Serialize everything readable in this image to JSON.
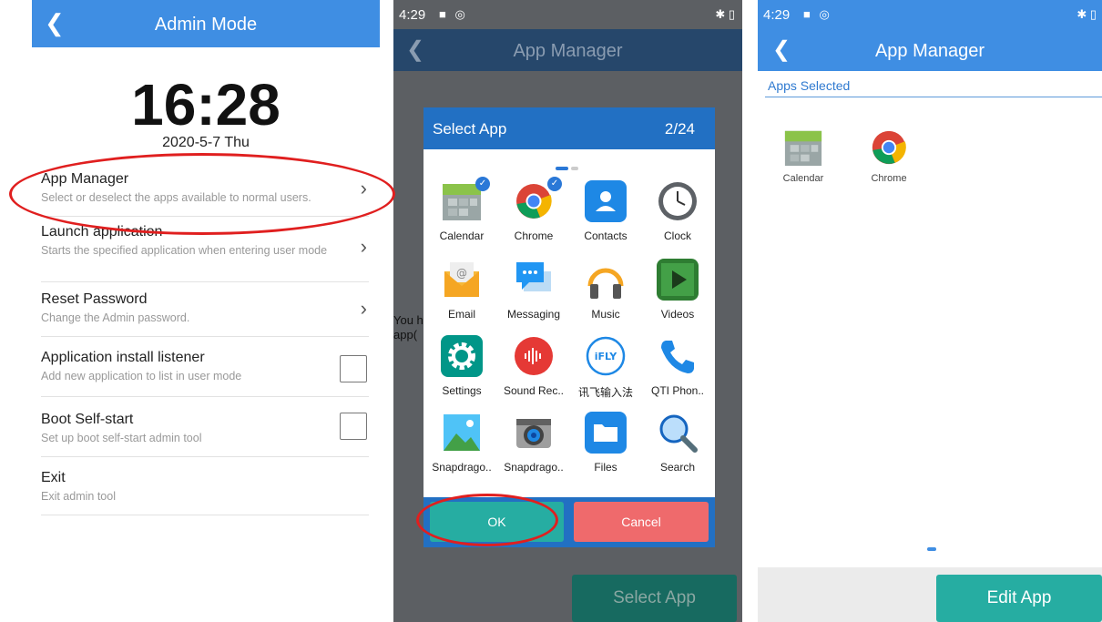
{
  "panel1": {
    "title": "Admin Mode",
    "back_icon": "chevron-left-icon",
    "clock": "16:28",
    "date": "2020-5-7 Thu",
    "items": [
      {
        "title": "App Manager",
        "subtitle": "Select or deselect the apps available to normal users.",
        "control": "chevron"
      },
      {
        "title": "Launch application",
        "subtitle": "Starts the specified application when entering user mode",
        "control": "chevron"
      },
      {
        "title": "Reset Password",
        "subtitle": "Change the Admin password.",
        "control": "chevron"
      },
      {
        "title": "Application install listener",
        "subtitle": "Add new application to list in user mode",
        "control": "checkbox"
      },
      {
        "title": "Boot Self-start",
        "subtitle": "Set up boot self-start admin tool",
        "control": "checkbox"
      },
      {
        "title": "Exit",
        "subtitle": "Exit admin tool",
        "control": "none"
      }
    ],
    "chevron_glyph": "›",
    "highlight_color": "#e01f1f"
  },
  "panel2": {
    "status_time": "4:29",
    "status_icons": "■ ◎",
    "status_right": "✱ ▯",
    "title": "App Manager",
    "background_text": "You h\napp(",
    "select_app_button": "Select App",
    "dialog": {
      "title": "Select App",
      "page": "2/24",
      "apps": [
        {
          "label": "Calendar",
          "icon": "calendar-icon",
          "checked": true
        },
        {
          "label": "Chrome",
          "icon": "chrome-icon",
          "checked": true
        },
        {
          "label": "Contacts",
          "icon": "contacts-icon",
          "checked": false
        },
        {
          "label": "Clock",
          "icon": "clock-icon",
          "checked": false
        },
        {
          "label": "Email",
          "icon": "email-icon",
          "checked": false
        },
        {
          "label": "Messaging",
          "icon": "messaging-icon",
          "checked": false
        },
        {
          "label": "Music",
          "icon": "music-icon",
          "checked": false
        },
        {
          "label": "Videos",
          "icon": "videos-icon",
          "checked": false
        },
        {
          "label": "Settings",
          "icon": "settings-icon",
          "checked": false
        },
        {
          "label": "Sound Rec..",
          "icon": "sound-recorder-icon",
          "checked": false
        },
        {
          "label": "讯飞输入法",
          "icon": "ifly-icon",
          "checked": false
        },
        {
          "label": "QTI Phon..",
          "icon": "phone-icon",
          "checked": false
        },
        {
          "label": "Snapdrago..",
          "icon": "gallery-icon",
          "checked": false
        },
        {
          "label": "Snapdrago..",
          "icon": "camera-icon",
          "checked": false
        },
        {
          "label": "Files",
          "icon": "files-icon",
          "checked": false
        },
        {
          "label": "Search",
          "icon": "search-icon",
          "checked": false
        }
      ],
      "ok": "OK",
      "cancel": "Cancel",
      "ifly_text": "iFLY"
    }
  },
  "panel3": {
    "status_time": "4:29",
    "status_icons": "■ ◎",
    "status_right": "✱ ▯",
    "title": "App Manager",
    "section": "Apps Selected",
    "apps": [
      {
        "label": "Calendar",
        "icon": "calendar-icon"
      },
      {
        "label": "Chrome",
        "icon": "chrome-icon"
      }
    ],
    "edit_button": "Edit App"
  },
  "colors": {
    "accent": "#3f8ee3",
    "teal": "#26ada2",
    "cancel": "#ef6a6c",
    "dialog_header": "#2270c3"
  }
}
